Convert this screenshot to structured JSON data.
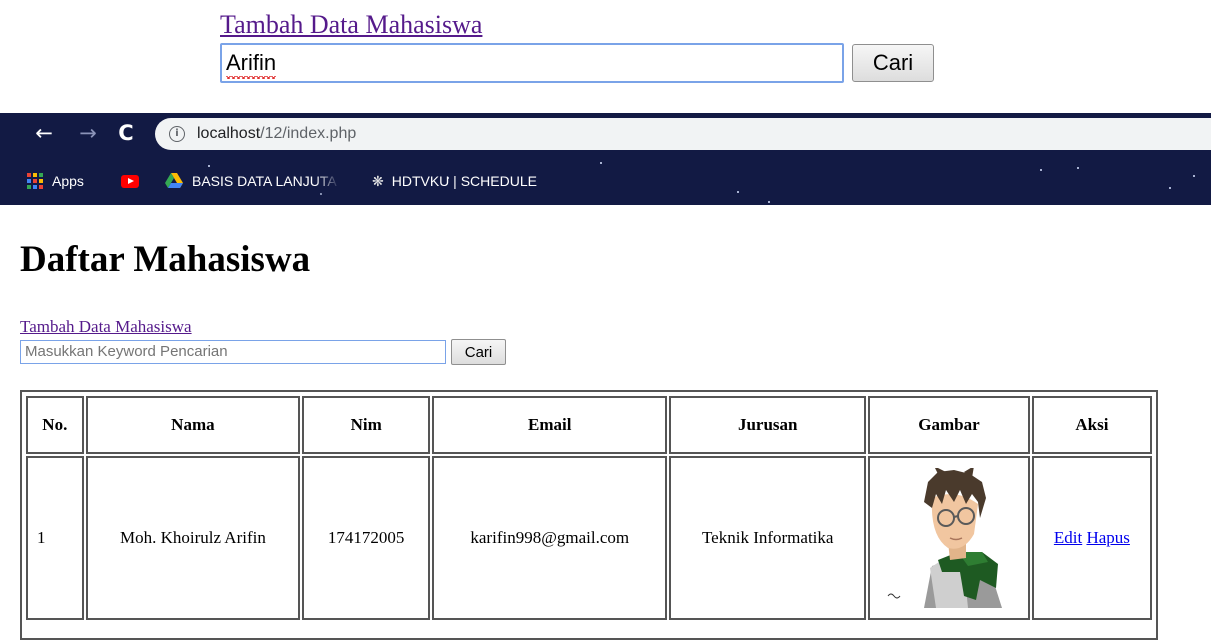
{
  "zoomed_snippet": {
    "add_link": "Tambah Data Mahasiswa",
    "search_value": "Arifin",
    "search_button": "Cari"
  },
  "browser": {
    "nav": {
      "back_icon": "arrow-left-icon",
      "forward_icon": "arrow-right-icon",
      "reload_icon": "reload-icon"
    },
    "url": {
      "host": "localhost",
      "path": "/12/index.php"
    },
    "bookmarks": [
      {
        "icon": "apps-grid-icon",
        "label": "Apps"
      },
      {
        "icon": "youtube-icon",
        "label": ""
      },
      {
        "icon": "google-drive-icon",
        "label": "BASIS DATA LANJUTA"
      },
      {
        "icon": "hdtvku-logo-icon",
        "label": "HDTVKU | SCHEDULE"
      }
    ],
    "colors": {
      "toolbar_bg": "#121a44",
      "omnibox_bg": "#f1f3f4"
    }
  },
  "page": {
    "title": "Daftar Mahasiswa",
    "add_link": "Tambah Data Mahasiswa",
    "search": {
      "placeholder": "Masukkan Keyword Pencarian",
      "button": "Cari"
    },
    "table": {
      "headers": [
        "No.",
        "Nama",
        "Nim",
        "Email",
        "Jurusan",
        "Gambar",
        "Aksi"
      ],
      "rows": [
        {
          "no": "1",
          "nama": "Moh. Khoirulz Arifin",
          "nim": "174172005",
          "email": "karifin998@gmail.com",
          "jurusan": "Teknik Informatika",
          "gambar": "anime-boy-avatar",
          "aksi": {
            "edit": "Edit",
            "hapus": "Hapus"
          }
        }
      ]
    },
    "colors": {
      "visited_link": "#551a8b",
      "link": "#0000ee",
      "input_focus_border": "#7aa3e8"
    }
  }
}
